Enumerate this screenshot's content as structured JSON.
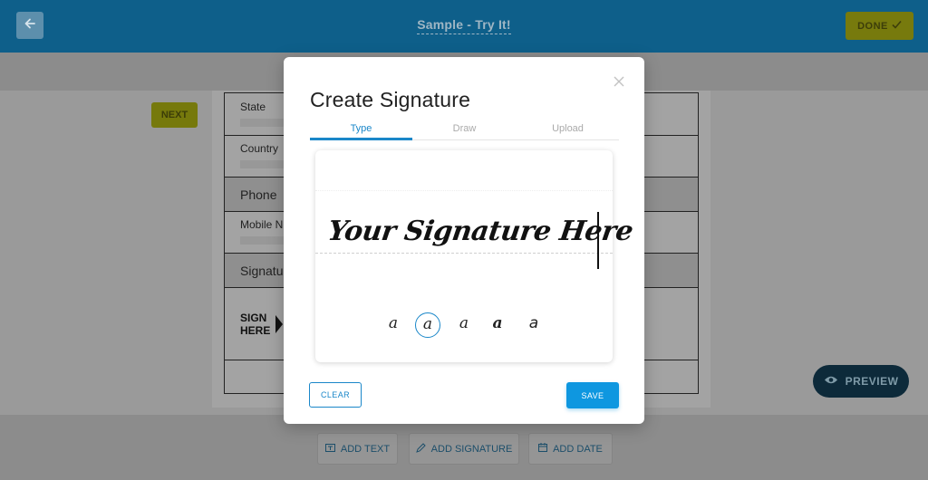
{
  "header": {
    "title": "Sample - Try It!",
    "done_label": "DONE",
    "back_icon": "arrow-left-icon",
    "done_icon": "checkmark-icon"
  },
  "document": {
    "next_label": "NEXT",
    "rows": {
      "state": "State",
      "country": "Country",
      "phone_section": "Phone",
      "mobile": "Mobile Nu",
      "signature_section": "Signatu"
    },
    "sign_here_line1": "SIGN",
    "sign_here_line2": "HERE"
  },
  "toolbar": {
    "add_text": "ADD TEXT",
    "add_signature": "ADD SIGNATURE",
    "add_date": "ADD DATE",
    "preview": "PREVIEW"
  },
  "modal": {
    "title": "Create Signature",
    "tabs": [
      "Type",
      "Draw",
      "Upload"
    ],
    "active_tab": "Type",
    "signature_text": "Your Signature Here",
    "font_glyphs": [
      "a",
      "a",
      "a",
      "a",
      "a"
    ],
    "selected_font_index": 1,
    "clear_label": "CLEAR",
    "save_label": "SAVE"
  },
  "colors": {
    "accent": "#1a87c9",
    "header_bg": "#0e5f8a",
    "done_bg": "#777a0d",
    "save_bg": "#0e97e0"
  }
}
